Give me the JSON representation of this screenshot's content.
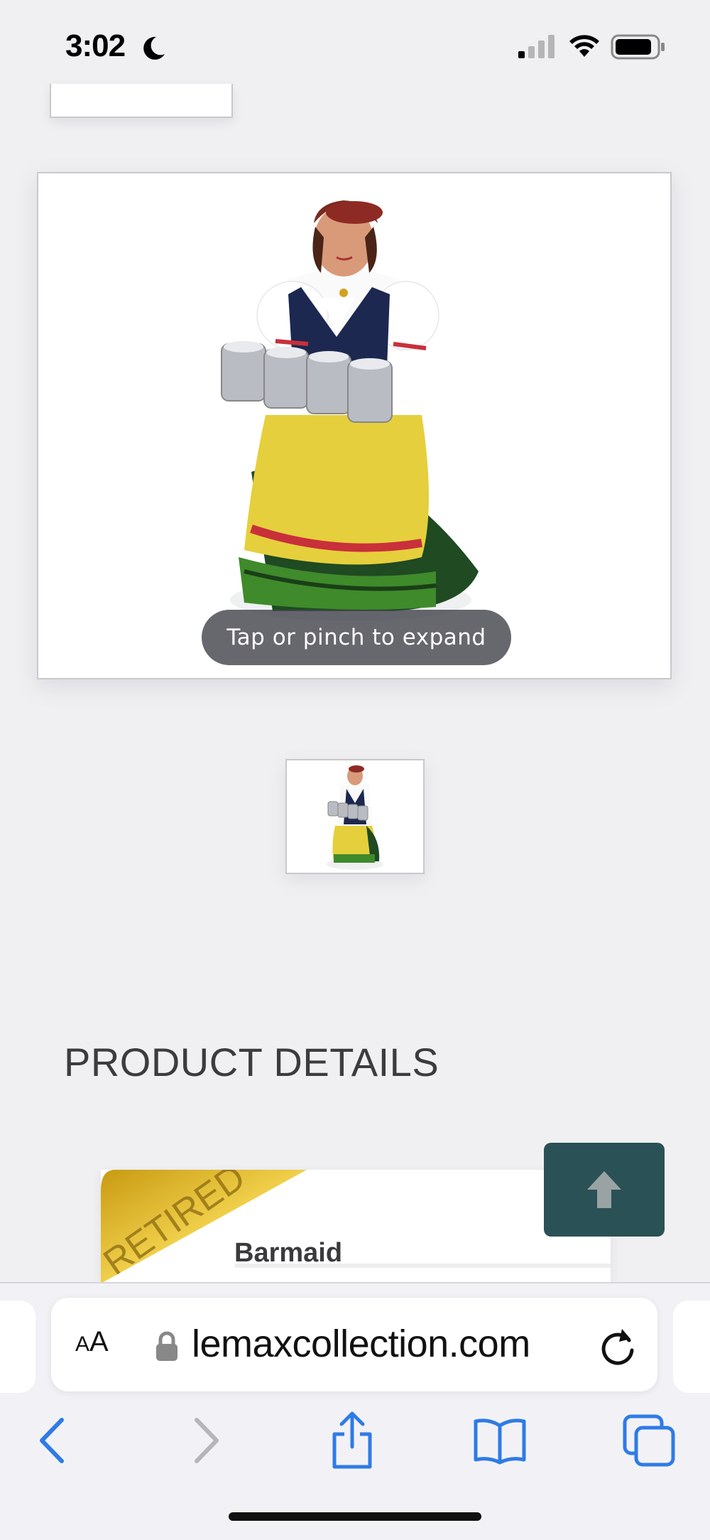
{
  "status_bar": {
    "time": "3:02"
  },
  "gallery": {
    "expand_hint": "Tap or pinch to expand"
  },
  "section_title": "PRODUCT DETAILS",
  "product": {
    "badge": "RETIRED",
    "name": "Barmaid"
  },
  "browser": {
    "text_size_label_small": "A",
    "text_size_label_large": "A",
    "url": "lemaxcollection.com"
  },
  "colors": {
    "scroll_top_bg": "#2a5155",
    "toolbar_icon": "#2f7be6",
    "ribbon_gold": "#d4a81a"
  }
}
